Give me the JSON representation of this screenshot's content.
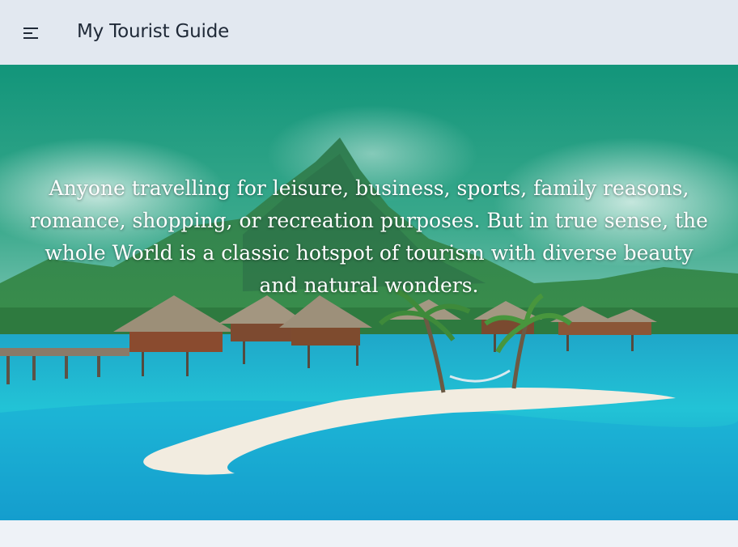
{
  "header": {
    "title": "My Tourist Guide",
    "menu_icon": "menu-icon"
  },
  "hero": {
    "text": "Anyone travelling for leisure, business, sports, family reasons, romance, shopping, or recreation purposes. But in true sense, the whole World is a classic hotspot of tourism with diverse beauty and natural wonders.",
    "image": "tropical-island-overwater-bungalows"
  },
  "colors": {
    "topbar": "#e2e8f0",
    "page_background": "#eef2f7",
    "sky_green": "#1a9a7a",
    "lagoon": "#19b8cf",
    "hero_text": "#ffffff"
  }
}
